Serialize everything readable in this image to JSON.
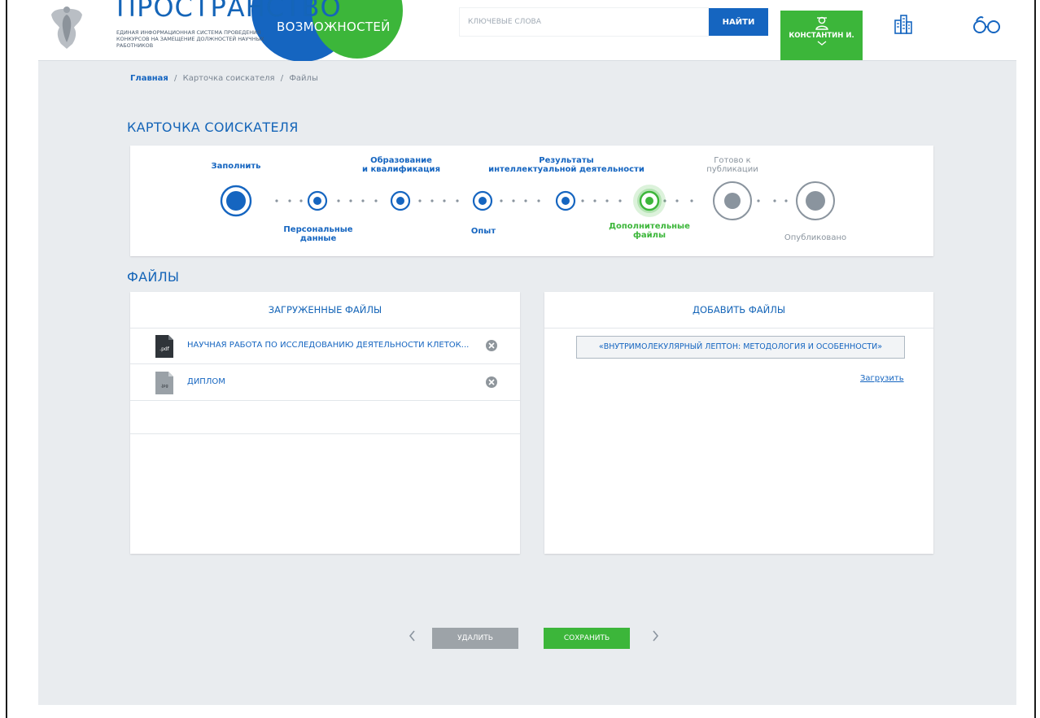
{
  "header": {
    "logo_title": "ПРОСТРАНСТВО",
    "logo_word": "ВОЗМОЖНОСТЕЙ",
    "logo_subtitle": "ЕДИНАЯ ИНФОРМАЦИОННАЯ СИСТЕМА ПРОВЕДЕНИЯ КОНКУРСОВ НА ЗАМЕЩЕНИЕ ДОЛЖНОСТЕЙ НАУЧНЫХ РАБОТНИКОВ",
    "search_placeholder": "КЛЮЧЕВЫЕ СЛОВА",
    "search_button": "НАЙТИ",
    "user_name": "КОНСТАНТИН И."
  },
  "breadcrumb": {
    "home": "Главная",
    "separator": "/",
    "card": "Карточка соискателя",
    "current": "Файлы"
  },
  "card_title": "КАРТОЧКА СОИСКАТЕЛЯ",
  "steps": [
    {
      "label_l1": "Заполнить",
      "label_l2": "",
      "state": "current"
    },
    {
      "label_l1": "Персональные",
      "label_l2": "данные",
      "state": "done"
    },
    {
      "label_l1": "Образование",
      "label_l2": "и квалификация",
      "state": "done"
    },
    {
      "label_l1": "Опыт",
      "label_l2": "",
      "state": "done"
    },
    {
      "label_l1": "Результаты",
      "label_l2": "интеллектуальной деятельности",
      "state": "done"
    },
    {
      "label_l1": "Дополнительные",
      "label_l2": "файлы",
      "state": "active"
    },
    {
      "label_l1": "Готово к",
      "label_l2": "публикации",
      "state": "pending"
    },
    {
      "label_l1": "Опубликовано",
      "label_l2": "",
      "state": "pending"
    }
  ],
  "files_title": "ФАЙЛЫ",
  "uploaded": {
    "title": "ЗАГРУЖЕННЫЕ ФАЙЛЫ",
    "files": [
      {
        "type": ".pdf",
        "name": "НАУЧНАЯ РАБОТА ПО ИССЛЕДОВАНИЮ ДЕЯТЕЛЬНОСТИ КЛЕТОК..."
      },
      {
        "type": ".jpg",
        "name": "ДИПЛОМ"
      }
    ]
  },
  "add_files": {
    "title": "ДОБАВИТЬ ФАЙЛЫ",
    "selected_file": "«ВНУТРИМОЛЕКУЛЯРНЫЙ ЛЕПТОН: МЕТОДОЛОГИЯ И ОСОБЕННОСТИ»",
    "upload_link": "Загрузить"
  },
  "actions": {
    "delete": "УДАЛИТЬ",
    "save": "СОХРАНИТЬ"
  },
  "colors": {
    "blue": "#1565c0",
    "green": "#3cb63a",
    "grey": "#8a949e",
    "background": "#e9ecef"
  }
}
